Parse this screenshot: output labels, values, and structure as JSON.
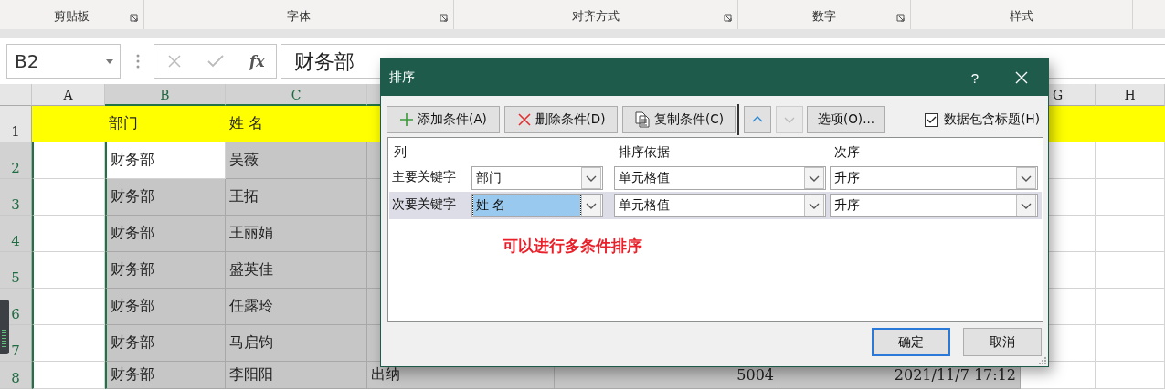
{
  "ribbon_groups": [
    {
      "label": "剪贴板",
      "launcher": true
    },
    {
      "label": "字体",
      "launcher": true
    },
    {
      "label": "对齐方式",
      "launcher": true
    },
    {
      "label": "数字",
      "launcher": true
    },
    {
      "label": "样式",
      "launcher": false
    }
  ],
  "formula_bar": {
    "name_box": "B2",
    "cancel_disabled": true,
    "enter_disabled": true,
    "function_label": "fx",
    "value": "财务部"
  },
  "sheet": {
    "columns": [
      {
        "header": "A",
        "selected": false
      },
      {
        "header": "B",
        "selected": true
      },
      {
        "header": "C",
        "selected": true
      },
      {
        "selected": true
      },
      {
        "selected": true
      },
      {
        "selected": true
      },
      {
        "header": "G",
        "selected": false
      },
      {
        "header": "H",
        "selected": false
      }
    ],
    "rows": [
      {
        "number": "1",
        "selected": false,
        "highlighted": true,
        "cells": {
          "B": {
            "text": "部门",
            "active": false
          },
          "C": {
            "text": "姓 名",
            "active": false
          }
        }
      },
      {
        "number": "2",
        "selected": true,
        "highlighted": false,
        "cells": {
          "B": {
            "text": "财务部",
            "active": true
          },
          "C": {
            "text": "吴薇",
            "active": false
          }
        }
      },
      {
        "number": "3",
        "selected": true,
        "highlighted": false,
        "cells": {
          "B": {
            "text": "财务部",
            "active": false
          },
          "C": {
            "text": "王拓",
            "active": false
          }
        }
      },
      {
        "number": "4",
        "selected": true,
        "highlighted": false,
        "cells": {
          "B": {
            "text": "财务部",
            "active": false
          },
          "C": {
            "text": "王丽娟",
            "active": false
          }
        }
      },
      {
        "number": "5",
        "selected": true,
        "highlighted": false,
        "cells": {
          "B": {
            "text": "财务部",
            "active": false
          },
          "C": {
            "text": "盛英佳",
            "active": false
          }
        }
      },
      {
        "number": "6",
        "selected": true,
        "highlighted": false,
        "cells": {
          "B": {
            "text": "财务部",
            "active": false
          },
          "C": {
            "text": "任露玲",
            "active": false
          }
        }
      },
      {
        "number": "7",
        "selected": true,
        "highlighted": false,
        "cells": {
          "B": {
            "text": "财务部",
            "active": false
          },
          "C": {
            "text": "马启钧",
            "active": false
          }
        }
      },
      {
        "number": "8",
        "selected": true,
        "highlighted": false,
        "cells": {
          "B": {
            "text": "财务部",
            "active": false
          },
          "C": {
            "text": "李阳阳",
            "active": false
          },
          "D": {
            "text": "出纳",
            "active": false
          },
          "E": {
            "text": "5004",
            "active": false,
            "kind": "number"
          },
          "F": {
            "text": "2021/11/7 17:12",
            "active": false,
            "kind": "number"
          }
        }
      }
    ]
  },
  "dialog": {
    "title": "排序",
    "help": "?",
    "toolbar": [
      {
        "kind": "add",
        "label": "添加条件(A)"
      },
      {
        "kind": "delete",
        "label": "删除条件(D)"
      },
      {
        "kind": "copy",
        "label": "复制条件(C)"
      },
      {
        "kind": "up",
        "disabled": false
      },
      {
        "kind": "down",
        "disabled": true
      },
      {
        "kind": "options",
        "label": "选项(O)..."
      }
    ],
    "header_checkbox": {
      "label": "数据包含标题(H)",
      "checked": true
    },
    "columns": [
      "列",
      "排序依据",
      "次序"
    ],
    "levels": [
      {
        "label": "主要关键字",
        "column": "部门",
        "sort_on": "单元格值",
        "order": "升序",
        "selected": false
      },
      {
        "label": "次要关键字",
        "column": "姓 名",
        "sort_on": "单元格值",
        "order": "升序",
        "selected": true
      }
    ],
    "note": "可以进行多条件排序",
    "buttons": [
      {
        "label": "确定",
        "default": true
      },
      {
        "label": "取消",
        "default": false
      }
    ]
  }
}
